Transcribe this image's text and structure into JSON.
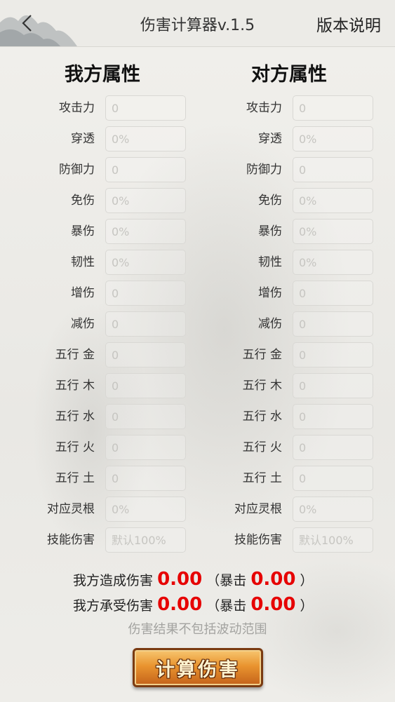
{
  "header": {
    "title": "伤害计算器v.1.5",
    "version_link": "版本说明"
  },
  "columns": [
    {
      "title": "我方属性",
      "rows": [
        {
          "label": "攻击力",
          "placeholder": "0"
        },
        {
          "label": "穿透",
          "placeholder": "0%"
        },
        {
          "label": "防御力",
          "placeholder": "0"
        },
        {
          "label": "免伤",
          "placeholder": "0%"
        },
        {
          "label": "暴伤",
          "placeholder": "0%"
        },
        {
          "label": "韧性",
          "placeholder": "0%"
        },
        {
          "label": "增伤",
          "placeholder": "0"
        },
        {
          "label": "减伤",
          "placeholder": "0"
        },
        {
          "label": "五行 金",
          "placeholder": "0"
        },
        {
          "label": "五行 木",
          "placeholder": "0"
        },
        {
          "label": "五行 水",
          "placeholder": "0"
        },
        {
          "label": "五行 火",
          "placeholder": "0"
        },
        {
          "label": "五行 土",
          "placeholder": "0"
        },
        {
          "label": "对应灵根",
          "placeholder": "0%"
        },
        {
          "label": "技能伤害",
          "placeholder": "默认100%"
        }
      ]
    },
    {
      "title": "对方属性",
      "rows": [
        {
          "label": "攻击力",
          "placeholder": "0"
        },
        {
          "label": "穿透",
          "placeholder": "0%"
        },
        {
          "label": "防御力",
          "placeholder": "0"
        },
        {
          "label": "免伤",
          "placeholder": "0%"
        },
        {
          "label": "暴伤",
          "placeholder": "0%"
        },
        {
          "label": "韧性",
          "placeholder": "0%"
        },
        {
          "label": "增伤",
          "placeholder": "0"
        },
        {
          "label": "减伤",
          "placeholder": "0"
        },
        {
          "label": "五行 金",
          "placeholder": "0"
        },
        {
          "label": "五行 木",
          "placeholder": "0"
        },
        {
          "label": "五行 水",
          "placeholder": "0"
        },
        {
          "label": "五行 火",
          "placeholder": "0"
        },
        {
          "label": "五行 土",
          "placeholder": "0"
        },
        {
          "label": "对应灵根",
          "placeholder": "0%"
        },
        {
          "label": "技能伤害",
          "placeholder": "默认100%"
        }
      ]
    }
  ],
  "results": {
    "dealt": {
      "label": "我方造成伤害",
      "value": "0.00",
      "crit_open": "（暴击",
      "crit_value": "0.00",
      "crit_close": "）"
    },
    "taken": {
      "label": "我方承受伤害",
      "value": "0.00",
      "crit_open": "（暴击",
      "crit_value": "0.00",
      "crit_close": "）"
    },
    "note": "伤害结果不包括波动范围"
  },
  "button": {
    "label": "计算伤害"
  },
  "icons": {
    "back": "chevron-left-icon",
    "decoration": "ink-mountain-icon"
  }
}
